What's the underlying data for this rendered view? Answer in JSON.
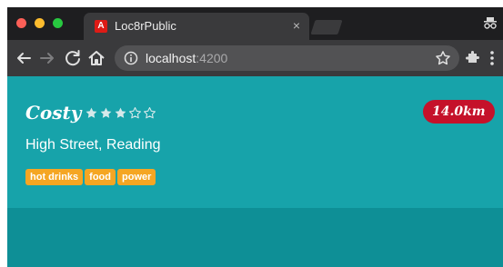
{
  "browser": {
    "tab": {
      "favicon_letter": "A",
      "title": "Loc8rPublic",
      "close_glyph": "×"
    },
    "toolbar": {
      "url_host": "localhost",
      "url_port": ":4200"
    }
  },
  "location": {
    "name": "Costy",
    "rating": 3,
    "rating_max": 5,
    "distance": "14.0km",
    "address": "High Street, Reading",
    "facilities": [
      "hot drinks",
      "food",
      "power"
    ]
  },
  "colors": {
    "page_accent": "#17a3aa",
    "distance_badge": "#c5112a",
    "tag": "#f5a623"
  }
}
